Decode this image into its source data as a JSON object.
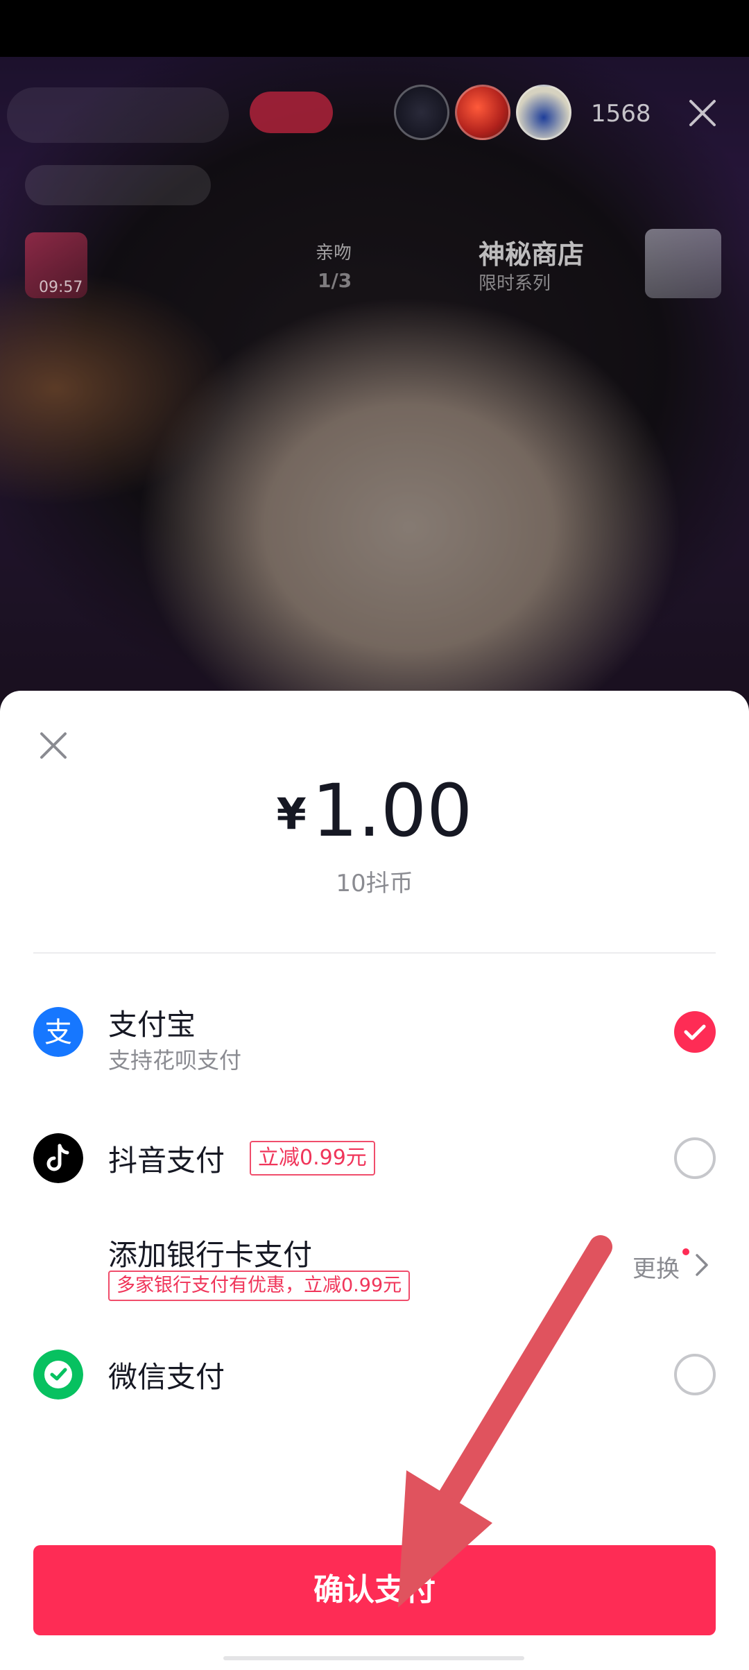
{
  "live": {
    "viewer_count": "1568",
    "kiss_label": "亲吻",
    "kiss_count": "1/3",
    "gift_timer": "09:57",
    "shop_title": "神秘商店",
    "shop_subtitle": "限时系列"
  },
  "payment": {
    "currency_symbol": "¥",
    "amount": "1.00",
    "coins": "10抖币",
    "methods": [
      {
        "title": "支付宝",
        "subtitle": "支持花呗支付",
        "icon": "alipay-icon",
        "selected": true
      },
      {
        "title": "抖音支付",
        "promo": "立减0.99元",
        "icon": "douyin-icon",
        "selected": false
      },
      {
        "title": "添加银行卡支付",
        "promo": "多家银行支付有优惠，立减0.99元",
        "action": "更换"
      },
      {
        "title": "微信支付",
        "icon": "wechat-icon",
        "selected": false
      }
    ],
    "confirm_label": "确认支付"
  },
  "colors": {
    "accent": "#fe2c55",
    "alipay": "#1677ff",
    "wechat": "#07c160",
    "text_primary": "#161823",
    "text_secondary": "#8a8b91"
  }
}
